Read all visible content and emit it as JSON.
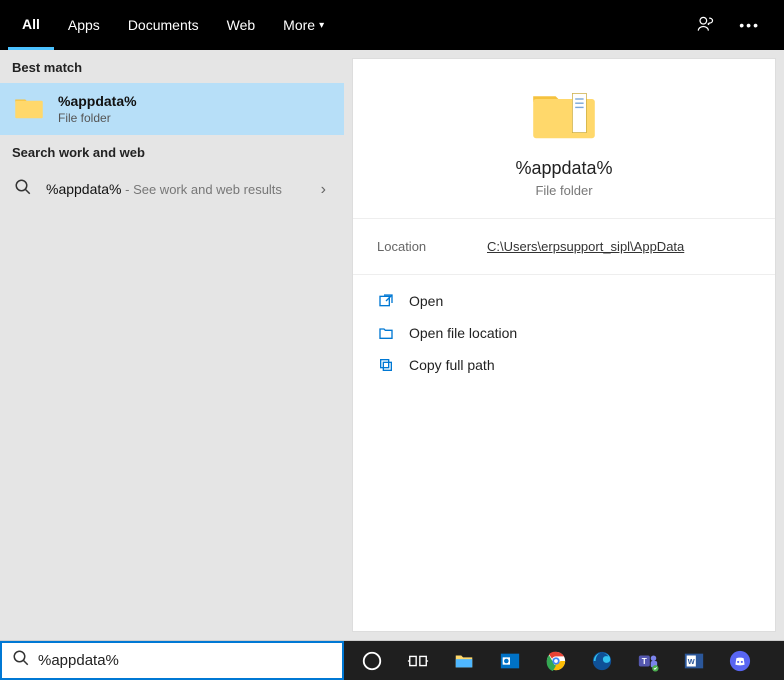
{
  "tabs": {
    "all": "All",
    "apps": "Apps",
    "documents": "Documents",
    "web": "Web",
    "more": "More"
  },
  "left": {
    "best_match_header": "Best match",
    "result": {
      "title": "%appdata%",
      "subtitle": "File folder"
    },
    "work_web_header": "Search work and web",
    "web_label": "%appdata%",
    "web_hint": " - See work and web results"
  },
  "preview": {
    "name": "%appdata%",
    "type": "File folder",
    "location_label": "Location",
    "location_value": "C:\\Users\\erpsupport_sipl\\AppData"
  },
  "actions": {
    "open": "Open",
    "open_location": "Open file location",
    "copy_path": "Copy full path"
  },
  "search": {
    "value": "%appdata%"
  }
}
